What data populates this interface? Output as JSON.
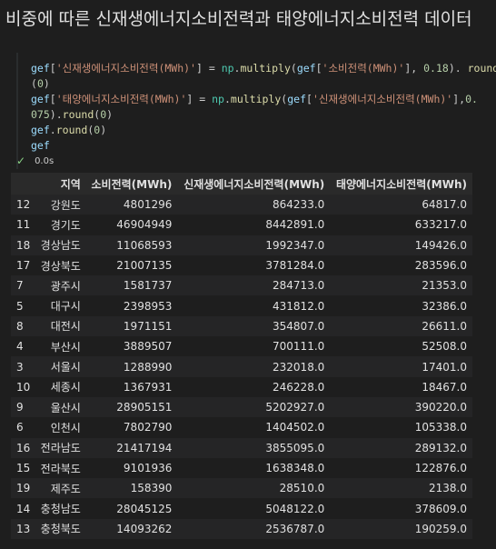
{
  "heading": "비중에 따른 신재생에너지소비전력과 태양에너지소비전력 데이터",
  "code": {
    "lines": [
      [
        [
          "kw",
          "gef"
        ],
        [
          "",
          "["
        ],
        [
          "str",
          "'신재생에너지소비전력(MWh)'"
        ],
        [
          "",
          "] = "
        ],
        [
          "np",
          "np"
        ],
        [
          "",
          "."
        ],
        [
          "fn",
          "multiply"
        ],
        [
          "",
          "("
        ],
        [
          "kw",
          "gef"
        ],
        [
          "",
          "["
        ],
        [
          "str",
          "'소비전력(MWh)'"
        ],
        [
          "",
          "], "
        ],
        [
          "num",
          "0.18"
        ],
        [
          "",
          "). "
        ],
        [
          "fn",
          "round"
        ]
      ],
      [
        [
          "",
          "("
        ],
        [
          "num",
          "0"
        ],
        [
          "",
          ")"
        ]
      ],
      [
        [
          "kw",
          "gef"
        ],
        [
          "",
          "["
        ],
        [
          "str",
          "'태양에너지소비전력(MWh)'"
        ],
        [
          "",
          "] = "
        ],
        [
          "np",
          "np"
        ],
        [
          "",
          "."
        ],
        [
          "fn",
          "multiply"
        ],
        [
          "",
          "("
        ],
        [
          "kw",
          "gef"
        ],
        [
          "",
          "["
        ],
        [
          "str",
          "'신재생에너지소비전력(MWh)'"
        ],
        [
          "",
          "],"
        ],
        [
          "num",
          "0."
        ]
      ],
      [
        [
          "num",
          "075"
        ],
        [
          "",
          ")."
        ],
        [
          "fn",
          "round"
        ],
        [
          "",
          "("
        ],
        [
          "num",
          "0"
        ],
        [
          "",
          ")"
        ]
      ],
      [
        [
          "kw",
          "gef"
        ],
        [
          "",
          "."
        ],
        [
          "fn",
          "round"
        ],
        [
          "",
          "("
        ],
        [
          "num",
          "0"
        ],
        [
          "",
          ")"
        ]
      ],
      [
        [
          "kw",
          "gef"
        ]
      ]
    ]
  },
  "status": {
    "icon": "check-icon",
    "time": "0.0s"
  },
  "table": {
    "columns": [
      "",
      "지역",
      "소비전력(MWh)",
      "신재생에너지소비전력(MWh)",
      "태양에너지소비전력(MWh)"
    ],
    "rows": [
      [
        "12",
        "강원도",
        "4801296",
        "864233.0",
        "64817.0"
      ],
      [
        "11",
        "경기도",
        "46904949",
        "8442891.0",
        "633217.0"
      ],
      [
        "18",
        "경상남도",
        "11068593",
        "1992347.0",
        "149426.0"
      ],
      [
        "17",
        "경상북도",
        "21007135",
        "3781284.0",
        "283596.0"
      ],
      [
        "7",
        "광주시",
        "1581737",
        "284713.0",
        "21353.0"
      ],
      [
        "5",
        "대구시",
        "2398953",
        "431812.0",
        "32386.0"
      ],
      [
        "8",
        "대전시",
        "1971151",
        "354807.0",
        "26611.0"
      ],
      [
        "4",
        "부산시",
        "3889507",
        "700111.0",
        "52508.0"
      ],
      [
        "3",
        "서울시",
        "1288990",
        "232018.0",
        "17401.0"
      ],
      [
        "10",
        "세종시",
        "1367931",
        "246228.0",
        "18467.0"
      ],
      [
        "9",
        "울산시",
        "28905151",
        "5202927.0",
        "390220.0"
      ],
      [
        "6",
        "인천시",
        "7802790",
        "1404502.0",
        "105338.0"
      ],
      [
        "16",
        "전라남도",
        "21417194",
        "3855095.0",
        "289132.0"
      ],
      [
        "15",
        "전라북도",
        "9101936",
        "1638348.0",
        "122876.0"
      ],
      [
        "19",
        "제주도",
        "158390",
        "28510.0",
        "2138.0"
      ],
      [
        "14",
        "충청남도",
        "28045125",
        "5048122.0",
        "378609.0"
      ],
      [
        "13",
        "충청북도",
        "14093262",
        "2536787.0",
        "190259.0"
      ]
    ]
  }
}
